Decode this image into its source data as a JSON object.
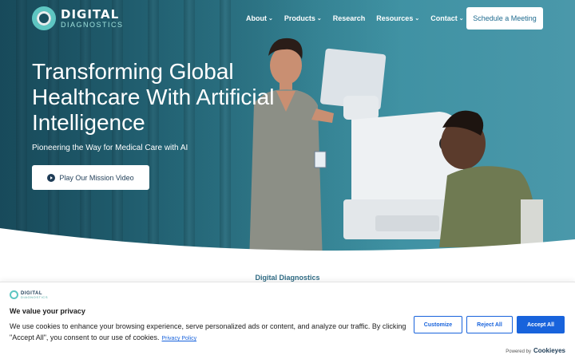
{
  "brand": {
    "name_line1": "DIGITAL",
    "name_line2": "DIAGNOSTICS"
  },
  "nav": {
    "items": [
      {
        "label": "About",
        "has_dropdown": true
      },
      {
        "label": "Products",
        "has_dropdown": true
      },
      {
        "label": "Research",
        "has_dropdown": false
      },
      {
        "label": "Resources",
        "has_dropdown": true
      },
      {
        "label": "Contact",
        "has_dropdown": true
      }
    ],
    "search_icon": "search-icon",
    "cta_label": "Schedule a Meeting"
  },
  "hero": {
    "title": "Transforming Global Healthcare With Artificial Intelligence",
    "subtitle": "Pioneering the Way for Medical Care with AI",
    "video_button_label": "Play Our Mission Video",
    "video_icon": "play-circle-icon"
  },
  "section": {
    "label": "Digital Diagnostics"
  },
  "cookie_banner": {
    "logo_line1": "DIGITAL",
    "logo_line2": "DIAGNOSTICS",
    "title": "We value your privacy",
    "body": "We use cookies to enhance your browsing experience, serve personalized ads or content, and analyze our traffic. By clicking \"Accept All\", you consent to our use of cookies.",
    "privacy_link": "Privacy Policy",
    "customize_label": "Customize",
    "reject_label": "Reject All",
    "accept_label": "Accept All",
    "powered_by": "Powered by",
    "powered_brand": "Cookieyes"
  },
  "colors": {
    "accent_teal": "#5ec6c2",
    "button_blue": "#1863dc",
    "hero_teal": "#2c7a8c",
    "cta_text": "#1f6b8f"
  }
}
